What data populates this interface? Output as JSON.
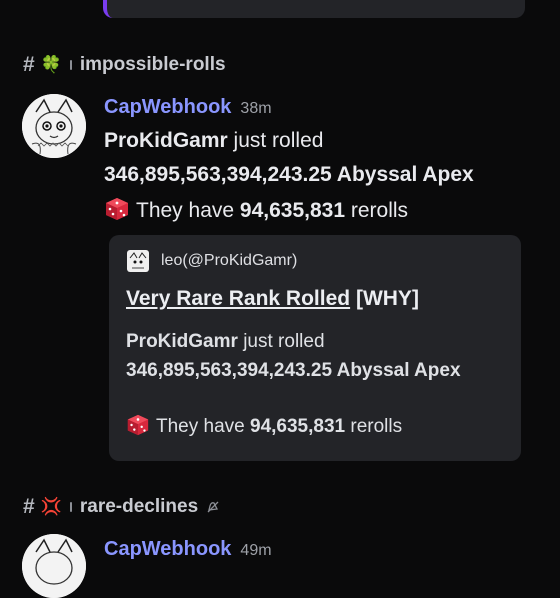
{
  "channels": [
    {
      "hash": "#",
      "emoji": "🍀",
      "name": "impossible-rolls"
    },
    {
      "hash": "#",
      "emoji": "💢",
      "name": "rare-declines",
      "muted_icon": "bell-slash-icon"
    }
  ],
  "messages": [
    {
      "author": "CapWebhook",
      "time": "38m",
      "line1": {
        "user": "ProKidGamr",
        "text": "just rolled"
      },
      "line2": "346,895,563,394,243.25 Abyssal Apex",
      "line3": {
        "prefix": "They have",
        "count": "94,635,831",
        "suffix": "rerolls"
      },
      "embed": {
        "author": "leo(@ProKidGamr)",
        "title_link": "Very Rare Rank Rolled",
        "title_suffix": "[WHY]",
        "line1_user": "ProKidGamr",
        "line1_text": "just rolled",
        "line2": "346,895,563,394,243.25 Abyssal Apex",
        "line3_prefix": "They have",
        "line3_count": "94,635,831",
        "line3_suffix": "rerolls"
      }
    },
    {
      "author": "CapWebhook",
      "time": "49m"
    }
  ],
  "colors": {
    "accent": "#7a3cf0",
    "author": "#8a96ff",
    "background": "#0a0a0b",
    "embed_bg": "#232428"
  }
}
